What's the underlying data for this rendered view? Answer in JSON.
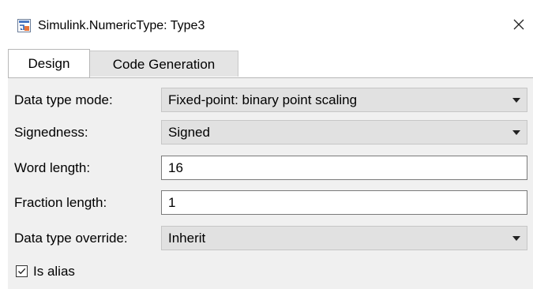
{
  "window": {
    "title": "Simulink.NumericType: Type3",
    "icon": "simulink-model-icon",
    "close_icon": "close-icon"
  },
  "tabs": [
    {
      "label": "Design",
      "active": true
    },
    {
      "label": "Code Generation",
      "active": false
    }
  ],
  "fields": {
    "data_type_mode": {
      "label": "Data type mode:",
      "value": "Fixed-point: binary point scaling"
    },
    "signedness": {
      "label": "Signedness:",
      "value": "Signed"
    },
    "word_length": {
      "label": "Word length:",
      "value": "16"
    },
    "fraction_length": {
      "label": "Fraction length:",
      "value": "1"
    },
    "data_type_override": {
      "label": "Data type override:",
      "value": "Inherit"
    }
  },
  "is_alias": {
    "label": "Is alias",
    "checked": true
  },
  "colors": {
    "panel": "#f0f0f0",
    "combo": "#e1e1e1",
    "inactive_tab": "#e4e4e4"
  }
}
